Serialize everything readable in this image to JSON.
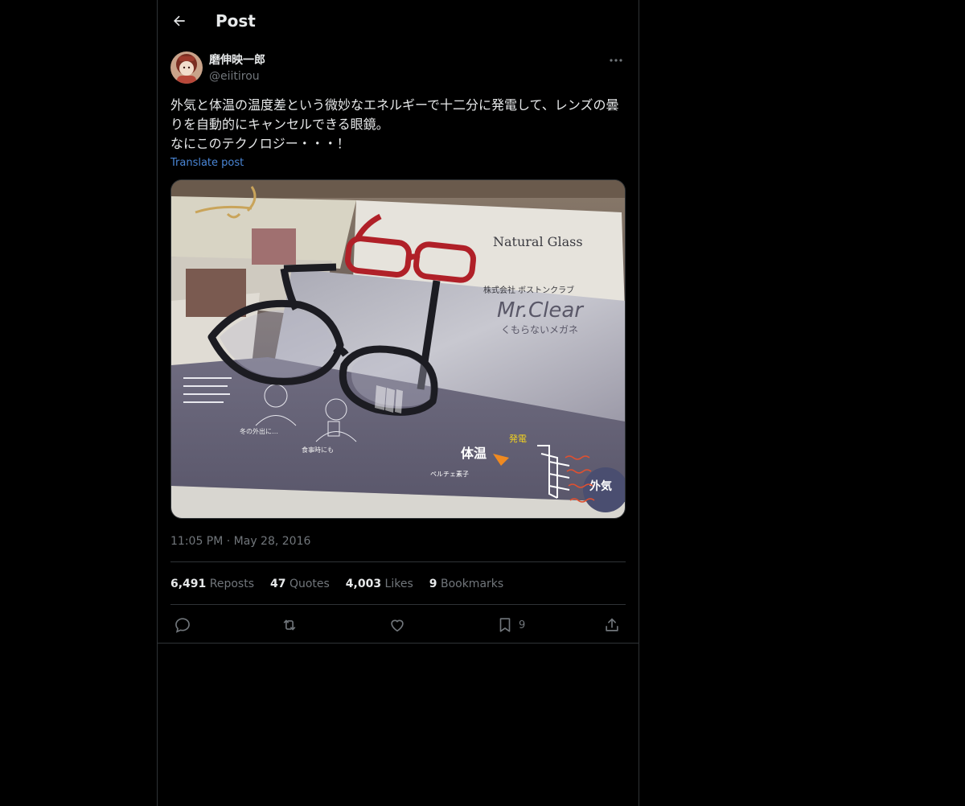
{
  "header": {
    "title": "Post",
    "back_icon": "arrow-left-icon"
  },
  "author": {
    "display_name": "磨伸映一郎",
    "handle": "@eiitirou",
    "more_icon": "more-horizontal-icon"
  },
  "post": {
    "text": "外気と体温の温度差という微妙なエネルギーで十二分に発電して、レンズの曇りを自動的にキャンセルできる眼鏡。\nなにこのテクノロジー・・・！",
    "translate_label": "Translate post",
    "timestamp": "11:05 PM · May 28, 2016"
  },
  "media": {
    "image_text": {
      "natural_glass": "Natural Glass",
      "brand": "Mr.Clear",
      "tagline": "くもらないメガネ",
      "company": "株式会社 ボストンクラブ",
      "body_temp": "体温",
      "power_gen": "発電",
      "outside_air": "外気",
      "peltier": "ペルチェ素子",
      "winter_outing": "冬の外出に…",
      "mealtime": "食事時にも"
    }
  },
  "stats": [
    {
      "count": "6,491",
      "label": "Reposts"
    },
    {
      "count": "47",
      "label": "Quotes"
    },
    {
      "count": "4,003",
      "label": "Likes"
    },
    {
      "count": "9",
      "label": "Bookmarks"
    }
  ],
  "actions": {
    "reply_icon": "reply-icon",
    "repost_icon": "repost-icon",
    "like_icon": "heart-icon",
    "bookmark_icon": "bookmark-icon",
    "bookmark_count": "9",
    "share_icon": "share-icon"
  },
  "colors": {
    "background": "#000000",
    "border": "#2f3336",
    "text_primary": "#e7e9ea",
    "text_secondary": "#71767b",
    "link": "#4a86d6"
  }
}
